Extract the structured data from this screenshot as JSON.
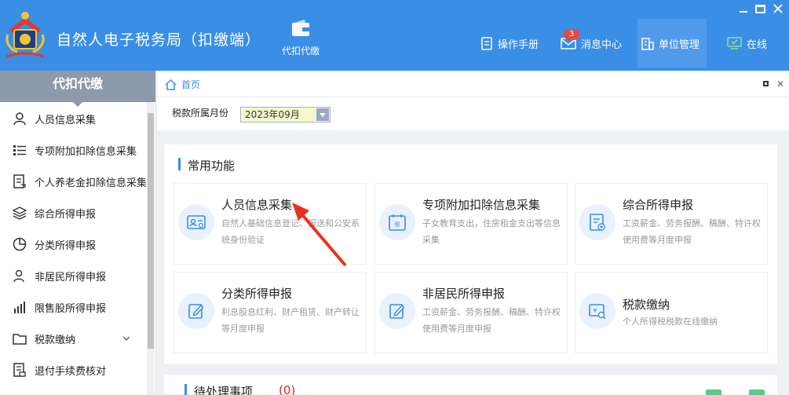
{
  "app": {
    "title": "自然人电子税务局（扣缴端）",
    "feature_label": "代扣代缴"
  },
  "top_nav": {
    "manual": "操作手册",
    "messages": "消息中心",
    "message_count": "3",
    "unit": "单位管理",
    "online": "在线"
  },
  "sidebar": {
    "title": "代扣代缴",
    "items": [
      {
        "label": "人员信息采集",
        "icon": "person-icon"
      },
      {
        "label": "专项附加扣除信息采集",
        "icon": "list-icon"
      },
      {
        "label": "个人养老金扣除信息采集",
        "icon": "document-icon"
      },
      {
        "label": "综合所得申报",
        "icon": "layers-icon"
      },
      {
        "label": "分类所得申报",
        "icon": "pie-chart-icon"
      },
      {
        "label": "非居民所得申报",
        "icon": "person-outline-icon"
      },
      {
        "label": "限售股所得申报",
        "icon": "bar-chart-icon"
      },
      {
        "label": "税款缴纳",
        "icon": "folder-icon"
      },
      {
        "label": "退付手续费核对",
        "icon": "receipt-icon"
      }
    ]
  },
  "breadcrumb": {
    "home": "首页"
  },
  "filter": {
    "label": "税款所属月份",
    "month": "2023年09月"
  },
  "common": {
    "title": "常用功能",
    "cards": [
      {
        "title": "人员信息采集",
        "desc": "自然人基础信息登记、报送和公安系统身份验证",
        "icon": "id-card-icon"
      },
      {
        "title": "专项附加扣除信息采集",
        "desc": "子女教育支出，住房租金支出等信息采集",
        "icon": "tax-calendar-icon"
      },
      {
        "title": "综合所得申报",
        "desc": "工资薪金、劳务报酬、稿酬、特许权使用费等月度申报",
        "icon": "report-icon"
      },
      {
        "title": "分类所得申报",
        "desc": "利息股息红利、财产租赁、财产转让等月度申报",
        "icon": "edit-icon"
      },
      {
        "title": "非居民所得申报",
        "desc": "工资薪金、劳务报酬、稿酬、特许权使用费等月度申报",
        "icon": "edit-icon"
      },
      {
        "title": "税款缴纳",
        "desc": "个人所得税税款在线缴纳",
        "icon": "payment-icon"
      }
    ]
  },
  "pending": {
    "title": "待处理事项",
    "count": "(0)"
  },
  "colors": {
    "header": "#3a8ee6",
    "sidebar_head": "#8c9aaa",
    "accent": "#3a8ee6",
    "alert": "#e02020"
  }
}
